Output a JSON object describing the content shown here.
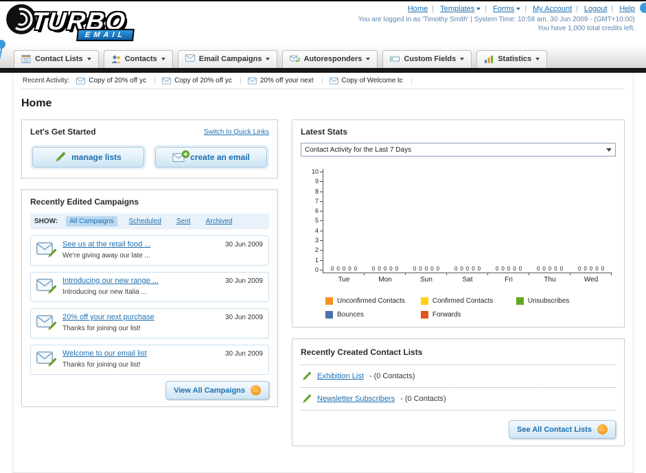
{
  "header": {
    "logo": {
      "title": "TURBO",
      "subtitle": "EMAIL"
    },
    "links": [
      {
        "label": "Home"
      },
      {
        "label": "Templates"
      },
      {
        "label": "Forms"
      },
      {
        "label": "My Account"
      },
      {
        "label": "Logout"
      },
      {
        "label": "Help"
      }
    ],
    "status": "You are logged in as 'Timothy Smith' | System Time: 10:58 am, 30 Jun 2009 - (GMT+10:00)",
    "credits": "You have 1,000 total credits left."
  },
  "nav": {
    "tabs": [
      {
        "label": "Contact Lists"
      },
      {
        "label": "Contacts"
      },
      {
        "label": "Email Campaigns"
      },
      {
        "label": "Autoresponders"
      },
      {
        "label": "Custom Fields"
      },
      {
        "label": "Statistics"
      }
    ]
  },
  "activity": {
    "label": "Recent Activity:",
    "items": [
      {
        "title": "Copy of 20% off yc"
      },
      {
        "title": "Copy of 20% off yc"
      },
      {
        "title": "20% off your next"
      },
      {
        "title": "Copy of Welcome tc"
      }
    ]
  },
  "page": {
    "title": "Home"
  },
  "get_started": {
    "title": "Let's Get Started",
    "switch_link": "Switch to Quick Links",
    "manage_lists": "manage lists",
    "create_email": "create an email"
  },
  "campaigns": {
    "title": "Recently Edited Campaigns",
    "show_label": "SHOW:",
    "filters": [
      {
        "label": "All Campaigns",
        "active": true
      },
      {
        "label": "Scheduled",
        "active": false
      },
      {
        "label": "Sent",
        "active": false
      },
      {
        "label": "Archived",
        "active": false
      }
    ],
    "items": [
      {
        "title": "See us at the retail food ...",
        "subtitle": "We're giving away our late ...",
        "date": "30 Jun 2009"
      },
      {
        "title": "Introducing our new range ...",
        "subtitle": "Introducing our new Italia ...",
        "date": "30 Jun 2009"
      },
      {
        "title": "20% off your next purchase",
        "subtitle": "Thanks for joining our list!",
        "date": "30 Jun 2009"
      },
      {
        "title": "Welcome to our email list",
        "subtitle": "Thanks for joining our list!",
        "date": "30 Jun 2009"
      }
    ],
    "view_all_label": "View All Campaigns"
  },
  "stats": {
    "title": "Latest Stats",
    "selector_value": "Contact Activity for the Last 7 Days"
  },
  "chart_data": {
    "type": "bar",
    "title": "Contact Activity for the Last 7 Days",
    "categories": [
      "Tue",
      "Mon",
      "Sun",
      "Sat",
      "Fri",
      "Thu",
      "Wed"
    ],
    "series": [
      {
        "name": "Unconfirmed Contacts",
        "color": "#f6921e",
        "values": [
          0,
          0,
          0,
          0,
          0,
          0,
          0
        ]
      },
      {
        "name": "Confirmed Contacts",
        "color": "#ffd11a",
        "values": [
          0,
          0,
          0,
          0,
          0,
          0,
          0
        ]
      },
      {
        "name": "Unsubscribes",
        "color": "#62a820",
        "values": [
          0,
          0,
          0,
          0,
          0,
          0,
          0
        ]
      },
      {
        "name": "Bounces",
        "color": "#4f6fa8",
        "values": [
          0,
          0,
          0,
          0,
          0,
          0,
          0
        ]
      },
      {
        "name": "Forwards",
        "color": "#e2521f",
        "values": [
          0,
          0,
          0,
          0,
          0,
          0,
          0
        ]
      }
    ],
    "ylim": [
      0,
      10
    ],
    "yticks": [
      10,
      9,
      8,
      7,
      6,
      5,
      4,
      3,
      2,
      1,
      0
    ],
    "value_labels_shown": true,
    "grid": false,
    "legend_position": "bottom"
  },
  "contact_lists": {
    "title": "Recently Created Contact Lists",
    "items": [
      {
        "name": "Exhibition List",
        "suffix": "- (0 Contacts)"
      },
      {
        "name": "Newsletter Subscribers",
        "suffix": "- (0 Contacts)"
      }
    ],
    "see_all_label": "See All Contact Lists"
  }
}
